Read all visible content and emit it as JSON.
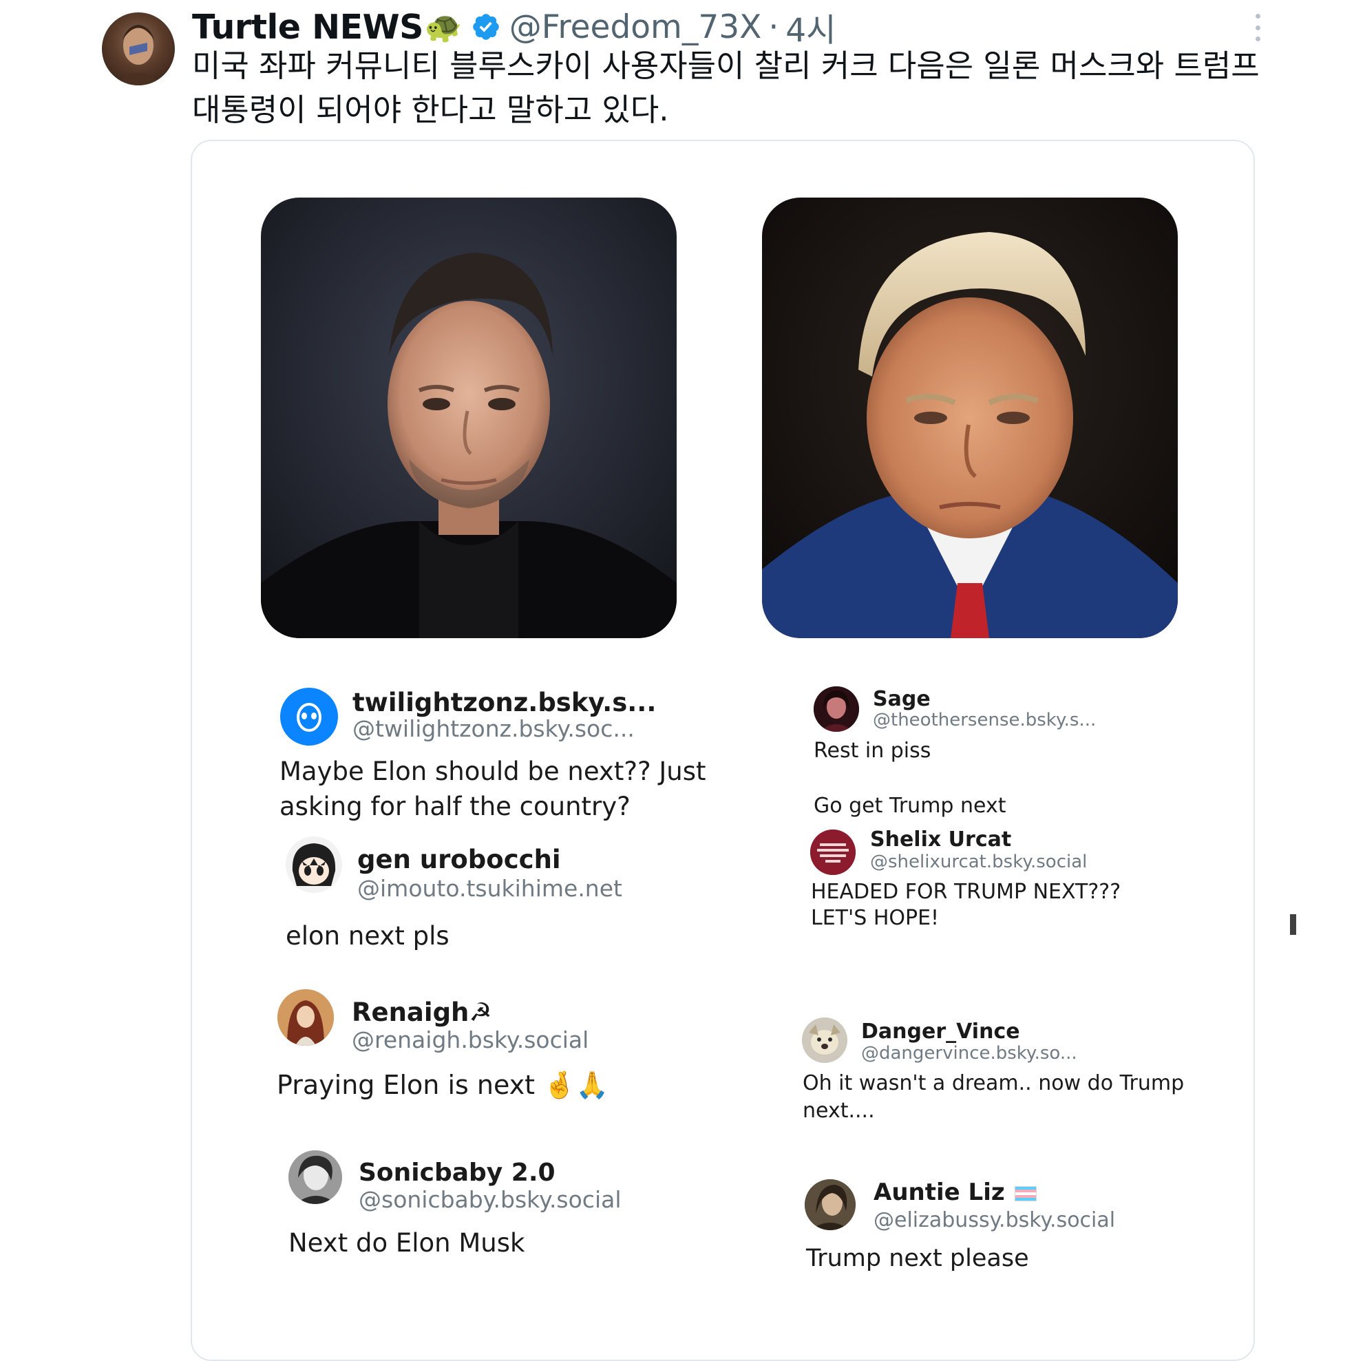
{
  "tweet": {
    "author_name": "Turtle NEWS",
    "author_emoji": "🐢",
    "verified": true,
    "handle": "@Freedom_73X",
    "separator": "·",
    "time": "4시",
    "text": "미국 좌파 커뮤니티 블루스카이 사용자들이 찰리 커크 다음은 일론 머스크와 트럼프 대통령이 되어야 한다고 말하고 있다."
  },
  "icons": {
    "verified": "verified-badge-icon",
    "more": "more-options-icon"
  },
  "colors": {
    "verified_blue": "#1d9bf0",
    "secondary_text": "#536471",
    "bluesky_blue": "#0a84ff"
  },
  "left_column": {
    "replies": [
      {
        "name": "twilightzonz.bsky.s...",
        "handle": "@twilightzonz.bsky.soc...",
        "text": "Maybe Elon should be next?? Just\nasking for half the country?"
      },
      {
        "name": "gen urobocchi",
        "handle": "@imouto.tsukihime.net",
        "text": "elon next pls"
      },
      {
        "name": "Renaigh☭",
        "handle": "@renaigh.bsky.social",
        "text": "Praying Elon is next 🤞🙏"
      },
      {
        "name": "Sonicbaby 2.0",
        "handle": "@sonicbaby.bsky.social",
        "text": "Next do Elon Musk"
      }
    ]
  },
  "right_column": {
    "replies": [
      {
        "name": "Sage",
        "handle": "@theothersense.bsky.s...",
        "text": "Rest in piss\n\nGo get Trump next"
      },
      {
        "name": "Shelix Urcat",
        "handle": "@shelixurcat.bsky.social",
        "text": "HEADED FOR TRUMP NEXT???\nLET'S HOPE!"
      },
      {
        "name": "Danger_Vince",
        "handle": "@dangervince.bsky.so...",
        "text": "Oh it wasn't a dream.. now do Trump\nnext...."
      },
      {
        "name": "Auntie Liz",
        "handle": "@elizabussy.bsky.social",
        "text": "Trump next please"
      }
    ]
  }
}
